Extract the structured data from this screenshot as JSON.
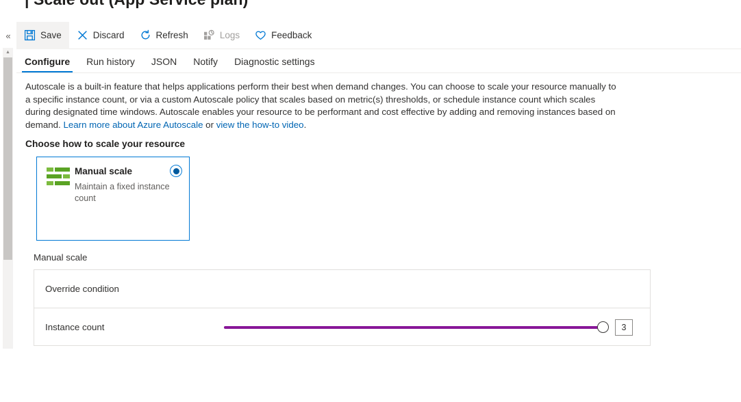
{
  "page": {
    "title": "| Scale out (App Service plan)"
  },
  "collapse": {
    "icon": "chevron-double-left-icon",
    "glyph": "«"
  },
  "scrollbar": {
    "up_glyph": "▲"
  },
  "toolbar": {
    "buttons": [
      {
        "label": "Save",
        "icon": "save-icon",
        "disabled": false,
        "highlighted": true
      },
      {
        "label": "Discard",
        "icon": "discard-x-icon",
        "disabled": false,
        "highlighted": false
      },
      {
        "label": "Refresh",
        "icon": "refresh-icon",
        "disabled": false,
        "highlighted": false
      },
      {
        "label": "Logs",
        "icon": "logs-icon",
        "disabled": true,
        "highlighted": false
      },
      {
        "label": "Feedback",
        "icon": "heart-icon",
        "disabled": false,
        "highlighted": false
      }
    ]
  },
  "tabs": {
    "items": [
      {
        "label": "Configure",
        "active": true
      },
      {
        "label": "Run history",
        "active": false
      },
      {
        "label": "JSON",
        "active": false
      },
      {
        "label": "Notify",
        "active": false
      },
      {
        "label": "Diagnostic settings",
        "active": false
      }
    ]
  },
  "description": {
    "part1": "Autoscale is a built-in feature that helps applications perform their best when demand changes. You can choose to scale your resource manually to a specific instance count, or via a custom Autoscale policy that scales based on metric(s) thresholds, or schedule instance count which scales during designated time windows. Autoscale enables your resource to be performant and cost effective by adding and removing instances based on demand. ",
    "link1": "Learn more about Azure Autoscale",
    "middle": " or ",
    "link2": "view the how-to video",
    "end": "."
  },
  "choose": {
    "heading": "Choose how to scale your resource",
    "option": {
      "title": "Manual scale",
      "subtitle": "Maintain a fixed instance count",
      "selected": true,
      "icon": "manual-scale-sliders-icon"
    }
  },
  "manual_scale": {
    "section_label": "Manual scale",
    "rows": [
      {
        "label": "Override condition",
        "type": "header"
      },
      {
        "label": "Instance count",
        "type": "slider"
      }
    ],
    "instance_count": {
      "value": "3",
      "slider_fill_percent": 100
    }
  },
  "colors": {
    "accent_blue": "#0078d4",
    "link_blue": "#0065b3",
    "slider_purple": "#881798",
    "icon_green": "#5aa324",
    "disabled_gray": "#a19f9d",
    "border_gray": "#e1dfdd"
  }
}
